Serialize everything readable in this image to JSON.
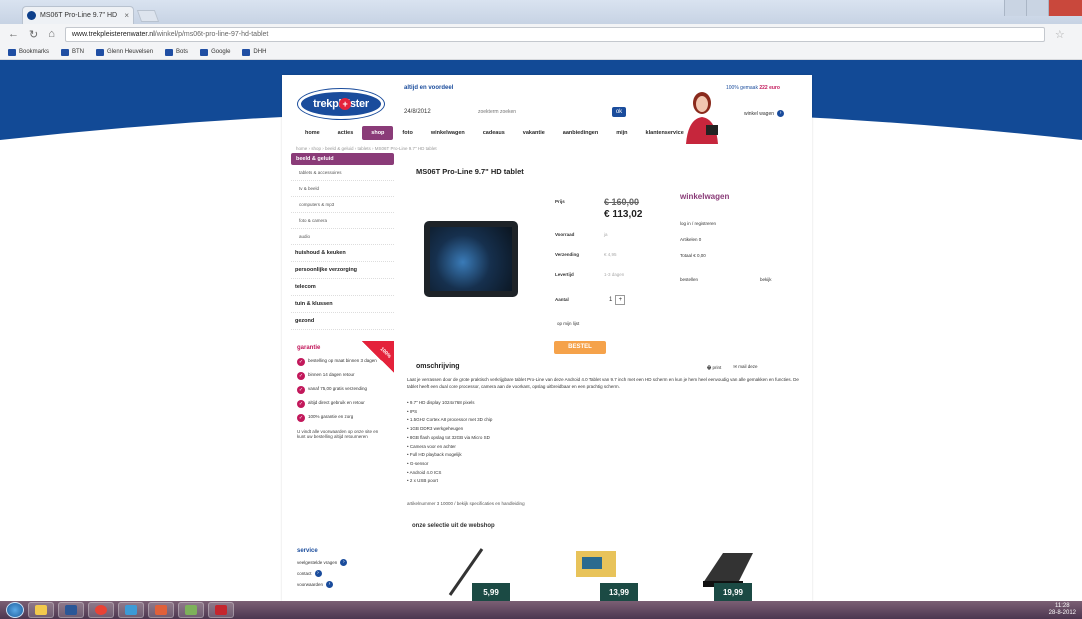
{
  "browser": {
    "tab_title": "MS06T Pro-Line 9.7\" HD",
    "url_host": "www.trekpleisterenwater.nl",
    "url_path": "/winkel/p/ms06t-pro-line-97-hd-tablet",
    "bookmarks": [
      "Bookmarks",
      "BTN",
      "Glenn Heuvelsen",
      "Bots",
      "Google",
      "DHH"
    ]
  },
  "site": {
    "logo_text": "trekpleister",
    "slogan": "altijd en voordeel",
    "date": "24/8/2012",
    "search_placeholder": "zoekterm zoeken",
    "search_button": "ok",
    "promo_text": "100% gemaak",
    "promo_highlight": "222 euro",
    "cart_label": "winkel wagen",
    "cart_icon_text": "›",
    "nav": [
      "home",
      "acties",
      "shop",
      "foto",
      "winkelwagen",
      "cadeaus",
      "vakantie",
      "aanbiedingen",
      "mijn",
      "klantenservice"
    ],
    "breadcrumb": "home › shop › beeld & geluid › tablets › MS06T Pro-Line 9.7\" HD tablet"
  },
  "sidebar": {
    "heading": "beeld & geluid",
    "subitems": [
      "tablets & accessoires",
      "tv & beeld",
      "computers & mp3",
      "foto & camera",
      "audio"
    ],
    "categories": [
      "huishoud & keuken",
      "persoonlijke verzorging",
      "telecom",
      "tuin & klussen",
      "gezond"
    ],
    "guarantee_title": "garantie",
    "ribbon_text": "100%",
    "guarantee_items": [
      "bestelling op maat binnen 3 dagen",
      "binnen 14 dagen retour",
      "vanaf 75,00 gratis verzending",
      "altijd direct gebruik en retour",
      "100% garantie en zorg"
    ],
    "guarantee_note": "U vindt alle voorwaarden op onze site en kunt uw bestelling altijd retourneren",
    "service_title": "service",
    "service_items": [
      "veelgestelde vragen",
      "contact",
      "voorwaarden"
    ]
  },
  "product": {
    "title": "MS06T Pro-Line 9.7\" HD tablet",
    "price_label": "Prijs",
    "old_price": "€ 160,00",
    "new_price": "€ 113,02",
    "stock_label": "Voorraad",
    "stock_value": "ja",
    "delivery_label": "Verzending",
    "delivery_value": "€ 4,95",
    "levertijd_label": "Levertijd",
    "levertijd_value": "1-3 dagen",
    "qty_label": "Aantal",
    "qty_value": "1",
    "qty_spin": "+",
    "wishlist": "op mijn lijst",
    "buy": "BESTEL",
    "shop_title": "winkelwagen",
    "meta": [
      "log in / registreren",
      "Artikelen 0",
      "Totaal € 0,00"
    ],
    "meta_right_label": "bestellen",
    "meta_right_value": "bekijk",
    "desc_title": "omschrijving",
    "desc_actions": [
      "print",
      "mail deze"
    ],
    "desc_body": "Laat je verrassen door de grote praktisch verkrijgbare tablet Pro-Line van deze Android 4.0 Tablet van 9.7 inch met een HD scherm en kun je hem heel eenvoudig van alle gemakken en functies. De tablet heeft een dual core processor, camera aan de voorkant, opslag uitbreidbaar en een prachtig scherm.",
    "desc_list": [
      "• 9.7\" HD display 1024x768 pixels",
      "• IPS",
      "• 1.5GHz Cortex A8 processor met 3D chip",
      "• 1GB DDR3 werkgeheugen",
      "• 8GB flash opslag tot 32GB via Micro SD",
      "• Camera voor en achter",
      "• Full HD playback mogelijk",
      "• G-sensor",
      "• Android 4.0 ICS",
      "• 2 x USB poort"
    ],
    "desc_foot": "artikelnummer 3 10000 / bekijk specificaties en handleiding",
    "selection_title": "onze selectie uit de webshop",
    "selection_prices": [
      "5,99",
      "13,99",
      "19,99"
    ]
  },
  "taskbar": {
    "time": "11:28",
    "date": "28-8-2012"
  }
}
